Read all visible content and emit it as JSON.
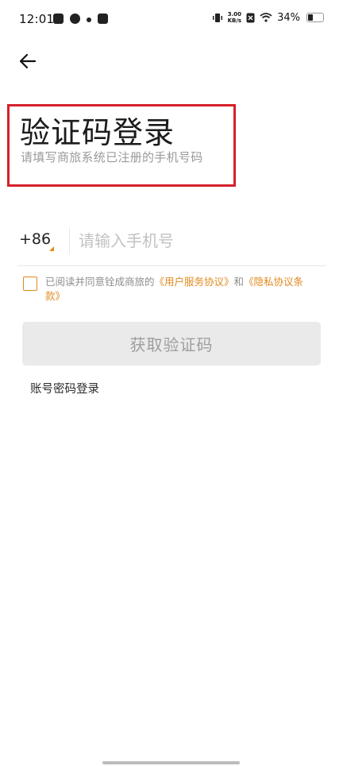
{
  "status_bar": {
    "time": "12:01",
    "net_speed_value": "3.00",
    "net_speed_unit": "KB/s",
    "battery_percent": "34%",
    "icons": [
      "app-icon",
      "sync-icon",
      "dot-icon",
      "tiktok-icon",
      "vibrate-icon",
      "sim-icon",
      "wifi-icon",
      "battery-icon"
    ]
  },
  "header": {
    "back_icon": "arrow-left-icon"
  },
  "title": "验证码登录",
  "subtitle": "请填写商旅系统已注册的手机号码",
  "phone": {
    "country_code": "+86",
    "placeholder": "请输入手机号",
    "value": ""
  },
  "agreement": {
    "prefix": "已阅读并同意铨成商旅的",
    "user_agreement": "《用户服务协议》",
    "joiner": "和",
    "privacy": "《隐私协议条款》",
    "checked": false
  },
  "get_code_button": "获取验证码",
  "password_login_link": "账号密码登录",
  "colors": {
    "accent": "#e08a1e",
    "highlight_border": "#d6202a",
    "button_disabled_bg": "#eaeaea",
    "button_disabled_text": "#9e9e9e"
  }
}
